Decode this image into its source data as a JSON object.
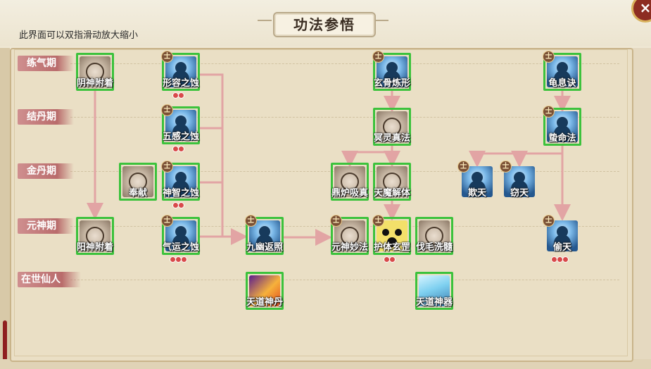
{
  "title": "功法参悟",
  "hint": "此界面可以双指滑动放大缩小",
  "close_icon": "×",
  "badge_text": "士",
  "realms": [
    "练气期",
    "结丹期",
    "金丹期",
    "元神期",
    "在世仙人"
  ],
  "nodes": {
    "n1": {
      "label": "阴神附着",
      "icon": "mask-icon",
      "badge": false,
      "dots": 0
    },
    "n2": {
      "label": "形容之蚀",
      "icon": "figure-icon",
      "badge": true,
      "dots": 2
    },
    "n3": {
      "label": "五感之蚀",
      "icon": "figure-icon",
      "badge": true,
      "dots": 2
    },
    "n4": {
      "label": "奉献",
      "icon": "mask-icon",
      "badge": false,
      "dots": 0
    },
    "n5": {
      "label": "神智之蚀",
      "icon": "figure-icon",
      "badge": true,
      "dots": 2
    },
    "n6": {
      "label": "阳神附着",
      "icon": "mask-icon",
      "badge": false,
      "dots": 0
    },
    "n7": {
      "label": "气运之蚀",
      "icon": "figure-icon",
      "badge": true,
      "dots": 3
    },
    "n8": {
      "label": "九幽返照",
      "icon": "figure-icon",
      "badge": true,
      "dots": 0
    },
    "n9": {
      "label": "天道神丹",
      "icon": "fire-icon",
      "badge": false,
      "dots": 0
    },
    "n10": {
      "label": "玄骨炼形",
      "icon": "figure-icon",
      "badge": true,
      "dots": 0
    },
    "n11": {
      "label": "冥灵真法",
      "icon": "mask-icon",
      "badge": false,
      "dots": 0
    },
    "n12": {
      "label": "鼎炉吸真",
      "icon": "mask-icon",
      "badge": false,
      "dots": 0
    },
    "n13": {
      "label": "天魔解体",
      "icon": "mask-icon",
      "badge": false,
      "dots": 0
    },
    "n14": {
      "label": "元神妙法",
      "icon": "mask-icon",
      "badge": true,
      "dots": 0
    },
    "n15": {
      "label": "护体玄罡",
      "icon": "eye-icon",
      "badge": true,
      "dots": 2
    },
    "n16": {
      "label": "伐毛洗髓",
      "icon": "mask-icon",
      "badge": false,
      "dots": 0
    },
    "n17": {
      "label": "天道神器",
      "icon": "crystal-icon",
      "badge": false,
      "dots": 0
    },
    "n18": {
      "label": "龟息诀",
      "icon": "figure-icon",
      "badge": true,
      "dots": 0
    },
    "n19": {
      "label": "蛰命法",
      "icon": "figure-icon",
      "badge": true,
      "dots": 0
    },
    "n20": {
      "label": "欺天",
      "icon": "figure-icon",
      "badge": true,
      "dots": 0
    },
    "n21": {
      "label": "窃天",
      "icon": "figure-icon",
      "badge": true,
      "dots": 0
    },
    "n22": {
      "label": "偷天",
      "icon": "figure-icon",
      "badge": true,
      "dots": 3
    }
  },
  "colors": {
    "link": "#e2a4a4",
    "frame": "#c9b48a",
    "realm": "#c27a7a",
    "highlight": "#3cc23c"
  }
}
